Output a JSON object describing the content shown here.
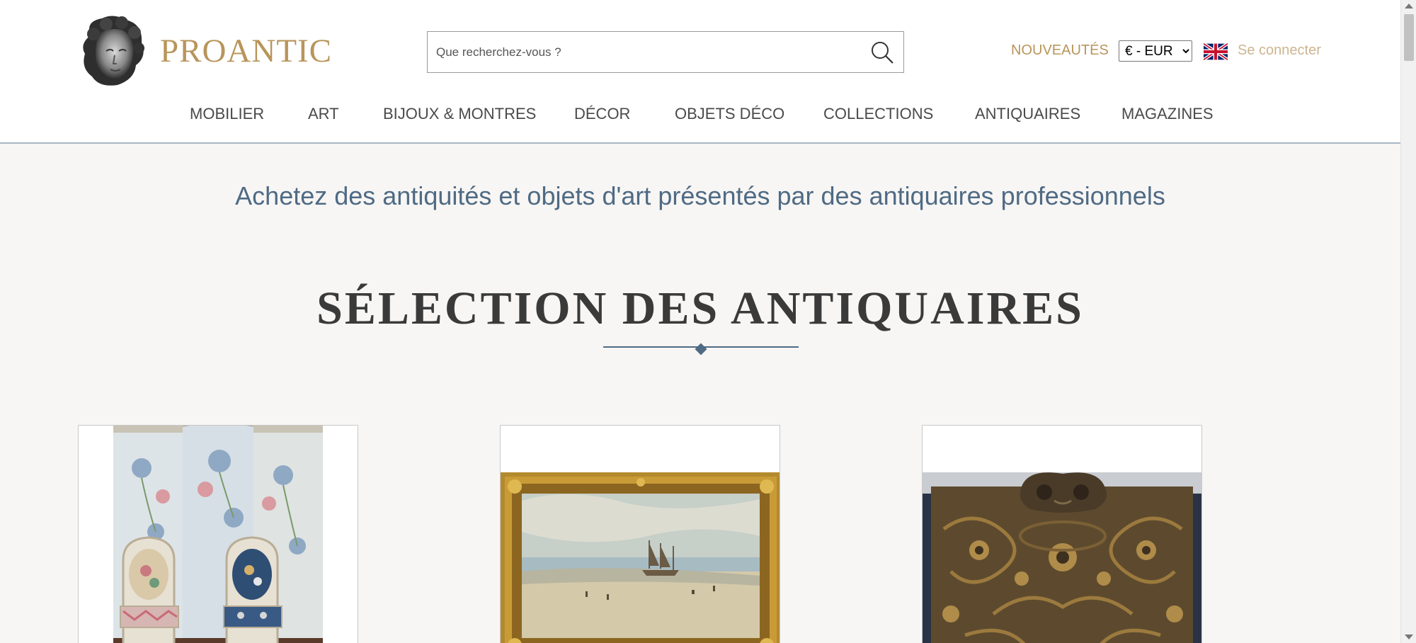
{
  "header": {
    "logo_text": "PROANTIC",
    "search": {
      "placeholder": "Que recherchez-vous ?",
      "value": ""
    },
    "nouveautes_label": "NOUVEAUTÉS",
    "currency": {
      "selected": "€ - EUR"
    },
    "login_label": "Se connecter"
  },
  "nav": {
    "items": [
      {
        "label": "MOBILIER"
      },
      {
        "label": "ART"
      },
      {
        "label": "BIJOUX & MONTRES"
      },
      {
        "label": "DÉCOR"
      },
      {
        "label": "OBJETS DÉCO"
      },
      {
        "label": "COLLECTIONS"
      },
      {
        "label": "ANTIQUAIRES"
      },
      {
        "label": "MAGAZINES"
      }
    ]
  },
  "main": {
    "tagline": "Achetez des antiquités et objets d'art présentés par des antiquaires professionnels",
    "section_title": "SÉLECTION DES ANTIQUAIRES"
  },
  "colors": {
    "brand_gold": "#b8955b",
    "accent_blue": "#4f6a84",
    "page_bg": "#f7f6f4"
  },
  "icons": {
    "search": "search-icon",
    "flag": "uk-flag-icon",
    "logo": "bust-logo-icon"
  }
}
